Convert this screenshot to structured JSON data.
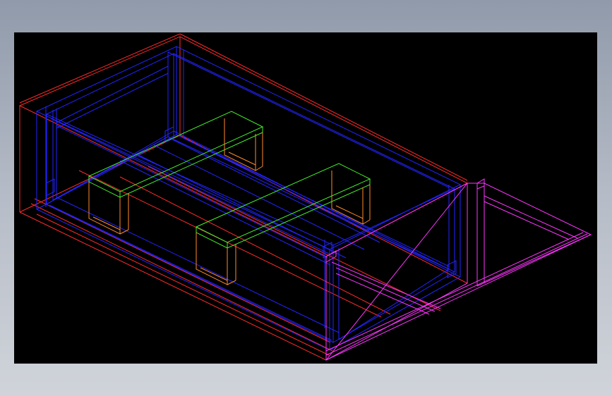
{
  "colors": {
    "frame": "#000000",
    "outer_body": "#ff2a2a",
    "inner_body": "#2323ff",
    "cross_beam": "#43f02b",
    "beam_support": "#ff8a2a",
    "ramp": "#ff35ff"
  },
  "parts": {
    "outer_body": "outer-body-red",
    "inner_frame": "inner-frame-blue",
    "beam_1": "cross-beam-green-1",
    "beam_2": "cross-beam-green-2",
    "ramp": "ramp-magenta"
  }
}
